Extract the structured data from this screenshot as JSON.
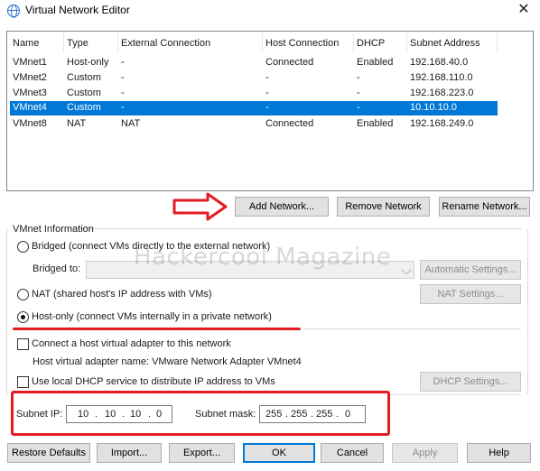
{
  "window": {
    "title": "Virtual Network Editor",
    "close_glyph": "✕"
  },
  "table": {
    "headers": [
      "Name",
      "Type",
      "External Connection",
      "Host Connection",
      "DHCP",
      "Subnet Address"
    ],
    "rows": [
      [
        "VMnet1",
        "Host-only",
        "-",
        "Connected",
        "Enabled",
        "192.168.40.0"
      ],
      [
        "VMnet2",
        "Custom",
        "-",
        "-",
        "-",
        "192.168.110.0"
      ],
      [
        "VMnet3",
        "Custom",
        "-",
        "-",
        "-",
        "192.168.223.0"
      ],
      [
        "VMnet4",
        "Custom",
        "-",
        "-",
        "-",
        "10.10.10.0"
      ],
      [
        "VMnet8",
        "NAT",
        "NAT",
        "Connected",
        "Enabled",
        "192.168.249.0"
      ]
    ],
    "selected_row": "VMnet4"
  },
  "list_buttons": {
    "add": "Add Network...",
    "remove": "Remove Network",
    "rename": "Rename Network..."
  },
  "vmnet_info": {
    "group_title": "VMnet Information",
    "bridged_label": "Bridged (connect VMs directly to the external network)",
    "bridged_to_label": "Bridged to:",
    "bridged_to_value": "",
    "auto_settings": "Automatic Settings...",
    "nat_label": "NAT (shared host's IP address with VMs)",
    "nat_settings": "NAT Settings...",
    "hostonly_label": "Host-only (connect VMs internally in a private network)",
    "selected_mode": "Host-only",
    "connect_adapter_label": "Connect a host virtual adapter to this network",
    "connect_adapter_checked": false,
    "adapter_name_label": "Host virtual adapter name: VMware Network Adapter VMnet4",
    "dhcp_label": "Use local DHCP service to distribute IP address to VMs",
    "dhcp_checked": false,
    "dhcp_settings": "DHCP Settings...",
    "subnet_ip_label": "Subnet IP:",
    "subnet_ip": [
      "10",
      "10",
      "10",
      "0"
    ],
    "subnet_mask_label": "Subnet mask:",
    "subnet_mask": [
      "255",
      "255",
      "255",
      "0"
    ]
  },
  "footer_buttons": {
    "restore": "Restore Defaults",
    "import": "Import...",
    "export": "Export...",
    "ok": "OK",
    "cancel": "Cancel",
    "apply": "Apply",
    "help": "Help"
  },
  "watermark": "Hackercool Magazine",
  "colors": {
    "selection": "#0078d7",
    "annotation_red": "#e31b23"
  }
}
